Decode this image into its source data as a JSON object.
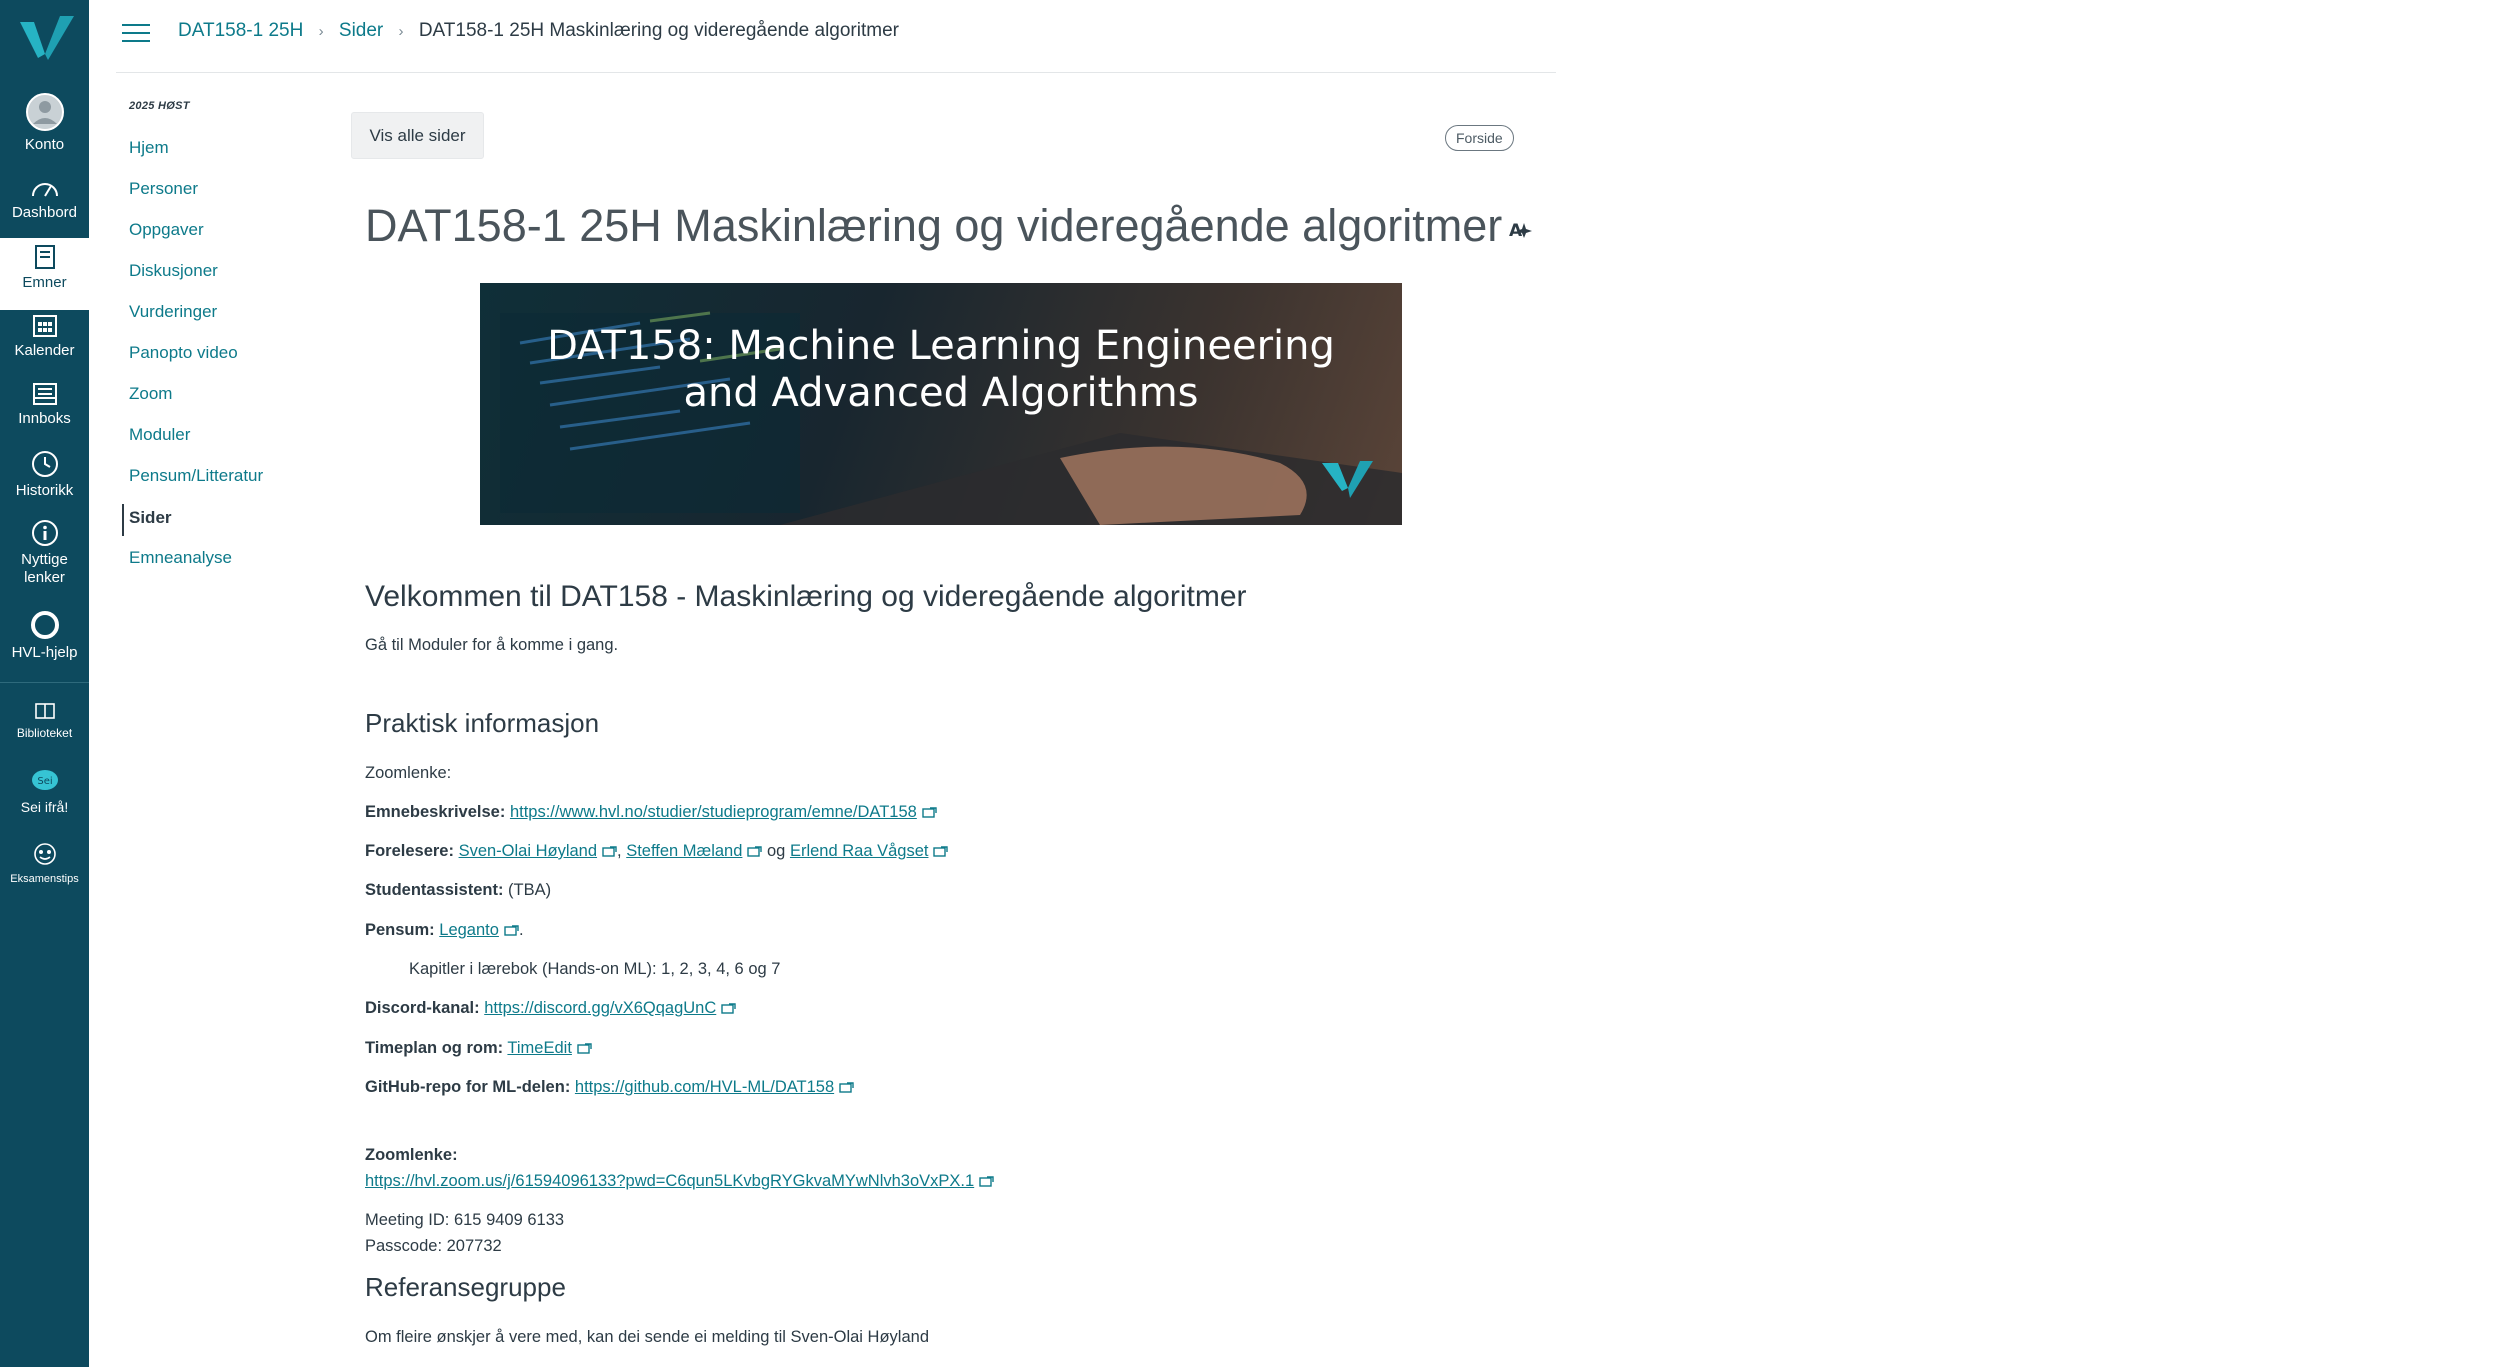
{
  "global_nav": {
    "items": [
      {
        "label": "Konto",
        "icon": "account-icon"
      },
      {
        "label": "Dashbord",
        "icon": "dashboard-icon"
      },
      {
        "label": "Emner",
        "icon": "courses-icon"
      },
      {
        "label": "Kalender",
        "icon": "calendar-icon"
      },
      {
        "label": "Innboks",
        "icon": "inbox-icon"
      },
      {
        "label": "Historikk",
        "icon": "history-icon"
      },
      {
        "label": "Nyttige lenker",
        "icon": "info-icon"
      },
      {
        "label": "HVL-hjelp",
        "icon": "help-icon"
      },
      {
        "label": "Biblioteket",
        "icon": "library-icon"
      },
      {
        "label": "Sei ifrå!",
        "icon": "feedback-icon"
      },
      {
        "label": "Eksamenstips",
        "icon": "exam-tips-icon"
      }
    ],
    "colors": {
      "background": "#0d4a5e",
      "accent": "#0d7a8a"
    }
  },
  "breadcrumb": {
    "items": [
      "DAT158-1 25H",
      "Sider"
    ],
    "current": "DAT158-1 25H Maskinlæring og videregående algoritmer"
  },
  "course_nav": {
    "term": "2025 HØST",
    "items": [
      "Hjem",
      "Personer",
      "Oppgaver",
      "Diskusjoner",
      "Vurderinger",
      "Panopto video",
      "Zoom",
      "Moduler",
      "Pensum/Litteratur",
      "Sider",
      "Emneanalyse"
    ],
    "active": "Sider"
  },
  "page": {
    "view_all_button": "Vis alle sider",
    "front_page_badge": "Forside",
    "title": "DAT158-1 25H Maskinlæring og videregående algoritmer",
    "banner_text_line1": "DAT158: Machine Learning Engineering",
    "banner_text_line2": "and Advanced Algorithms",
    "welcome_heading": "Velkommen til DAT158 - Maskinlæring og videregående algoritmer",
    "intro": "Gå til Moduler for å komme i gang.",
    "practical_heading": "Praktisk informasjon",
    "zoom_short": "Zoomlenke:",
    "desc_label": "Emnebeskrivelse:",
    "desc_link": "https://www.hvl.no/studier/studieprogram/emne/DAT158",
    "lecturers_label": "Forelesere:",
    "lecturer1": "Sven-Olai Høyland",
    "lecturer2": "Steffen Mæland",
    "lecturers_and": "og",
    "lecturer3": "Erlend Raa Vågset",
    "assistant_label": "Studentassistent:",
    "assistant_value": "(TBA)",
    "curriculum_label": "Pensum:",
    "curriculum_link": "Leganto",
    "curriculum_detail": "Kapitler i lærebok (Hands-on ML): 1, 2, 3, 4, 6 og 7",
    "discord_label": "Discord-kanal:",
    "discord_link": "https://discord.gg/vX6QqagUnC",
    "schedule_label": "Timeplan og rom:",
    "schedule_link": "TimeEdit",
    "github_label": "GitHub-repo for ML-delen:",
    "github_link": "https://github.com/HVL-ML/DAT158",
    "zoom_label": "Zoomlenke:",
    "zoom_link": "https://hvl.zoom.us/j/61594096133?pwd=C6qun5LKvbgRYGkvaMYwNlvh3oVxPX.1",
    "meeting_id": "Meeting ID: 615 9409 6133",
    "passcode": "Passcode: 207732",
    "ref_heading": "Referansegruppe",
    "ref_text": "Om fleire ønskjer å vere med, kan dei sende ei melding til Sven-Olai Høyland"
  }
}
